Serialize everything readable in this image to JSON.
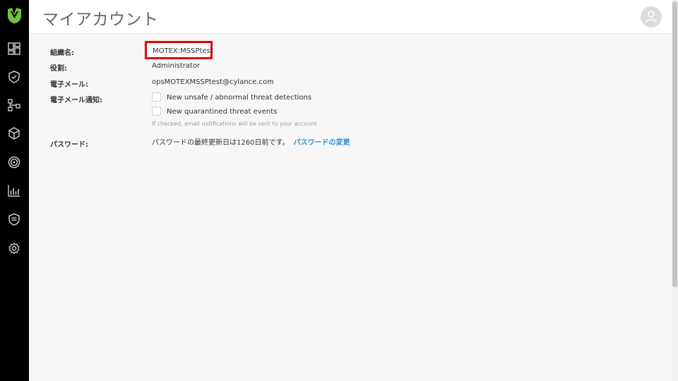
{
  "header": {
    "title": "マイアカウント"
  },
  "colors": {
    "sidebar": "#000000",
    "accent": "#2a8fd4",
    "highlight": "#e60000",
    "logo": "#6fc13e"
  },
  "sidebar": {
    "icons": [
      "cylance-logo-icon",
      "dashboard-icon",
      "shield-icon",
      "network-icon",
      "cube-icon",
      "radar-icon",
      "bar-chart-icon",
      "list-shield-icon",
      "gear-icon"
    ]
  },
  "account": {
    "org_label": "組織名:",
    "org_value": "MOTEX:MSSPtest",
    "role_label": "役割:",
    "role_value": "Administrator",
    "email_label": "電子メール:",
    "email_value": "opsMOTEXMSSPtest@cylance.com",
    "notify_label": "電子メール通知:",
    "notify_option1": "New unsafe / abnormal threat detections",
    "notify_option2": "New quarantined threat events",
    "notify_hint": "If checked, email notifications will be sent to your account",
    "password_label": "パスワード:",
    "password_text": "パスワードの最終更新日は1260日前です。",
    "password_link": "パスワードの変更"
  }
}
